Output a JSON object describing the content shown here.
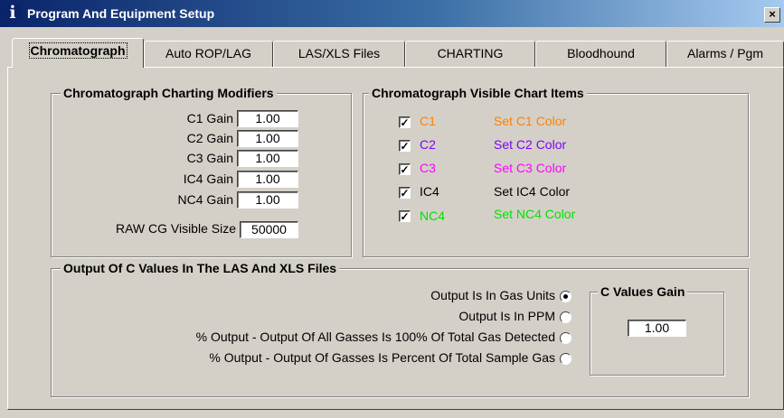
{
  "window": {
    "title": "Program And Equipment Setup",
    "close_symbol": "×",
    "icon_glyph": "i"
  },
  "tabs": [
    {
      "label": "Chromatograph"
    },
    {
      "label": "Auto ROP/LAG"
    },
    {
      "label": "LAS/XLS Files"
    },
    {
      "label": "CHARTING"
    },
    {
      "label": "Bloodhound"
    },
    {
      "label": "Alarms / Pgm"
    }
  ],
  "modifiers": {
    "title": "Chromatograph Charting Modifiers",
    "gains": [
      {
        "label": "C1 Gain",
        "value": "1.00"
      },
      {
        "label": "C2 Gain",
        "value": "1.00"
      },
      {
        "label": "C3 Gain",
        "value": "1.00"
      },
      {
        "label": "IC4 Gain",
        "value": "1.00"
      },
      {
        "label": "NC4 Gain",
        "value": "1.00"
      }
    ],
    "raw_label": "RAW CG Visible Size",
    "raw_value": "50000"
  },
  "visible_items": {
    "title": "Chromatograph Visible Chart Items",
    "items": [
      {
        "label": "C1",
        "checked": true,
        "set_color_label": "Set C1 Color",
        "color": "#ff8000"
      },
      {
        "label": "C2",
        "checked": true,
        "set_color_label": "Set C2 Color",
        "color": "#8000ff"
      },
      {
        "label": "C3",
        "checked": true,
        "set_color_label": "Set C3 Color",
        "color": "#ff00ff"
      },
      {
        "label": "IC4",
        "checked": true,
        "set_color_label": "Set IC4 Color",
        "color": "#000000"
      },
      {
        "label": "NC4",
        "checked": true,
        "set_color_label": "Set NC4 Color",
        "color": "#00e000"
      }
    ],
    "check_glyph": "✓"
  },
  "output": {
    "title": "Output Of C Values In The LAS And XLS Files",
    "options": [
      {
        "label": "Output Is In Gas Units",
        "selected": true
      },
      {
        "label": "Output Is In PPM",
        "selected": false
      },
      {
        "label": "% Output - Output Of All Gasses Is 100% Of Total Gas Detected",
        "selected": false
      },
      {
        "label": "% Output - Output Of Gasses Is Percent Of Total Sample Gas",
        "selected": false
      }
    ],
    "gain_title": "C Values Gain",
    "gain_value": "1.00"
  }
}
